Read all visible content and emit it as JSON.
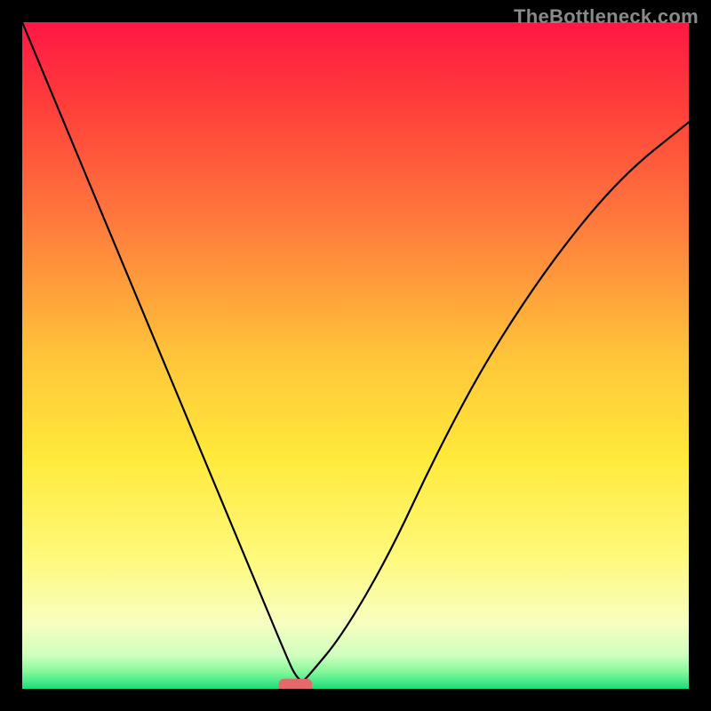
{
  "watermark": "TheBottleneck.com",
  "chart_data": {
    "type": "line",
    "title": "",
    "xlabel": "",
    "ylabel": "",
    "xlim": [
      0,
      100
    ],
    "ylim": [
      0,
      100
    ],
    "grid": false,
    "legend": false,
    "gradient_stops": [
      {
        "offset": 0.0,
        "color": "#ff1744"
      },
      {
        "offset": 0.12,
        "color": "#ff3d3b"
      },
      {
        "offset": 0.3,
        "color": "#ff7a3c"
      },
      {
        "offset": 0.5,
        "color": "#ffc43a"
      },
      {
        "offset": 0.65,
        "color": "#ffe93a"
      },
      {
        "offset": 0.8,
        "color": "#fff97a"
      },
      {
        "offset": 0.9,
        "color": "#f7ffbf"
      },
      {
        "offset": 0.95,
        "color": "#cfffbf"
      },
      {
        "offset": 0.975,
        "color": "#84f79a"
      },
      {
        "offset": 1.0,
        "color": "#14e07a"
      }
    ],
    "series": [
      {
        "name": "curve",
        "x": [
          0,
          5,
          10,
          15,
          20,
          25,
          30,
          35,
          40,
          41,
          42,
          43,
          48,
          55,
          62,
          70,
          80,
          90,
          100
        ],
        "values": [
          100,
          88,
          76,
          64,
          52,
          40,
          28,
          16,
          4,
          2,
          1,
          2,
          8,
          20,
          35,
          50,
          65,
          77,
          85
        ]
      }
    ],
    "marker": {
      "x": 41,
      "y": 0.5,
      "width": 5,
      "height": 2,
      "color": "#e46a6a"
    }
  }
}
